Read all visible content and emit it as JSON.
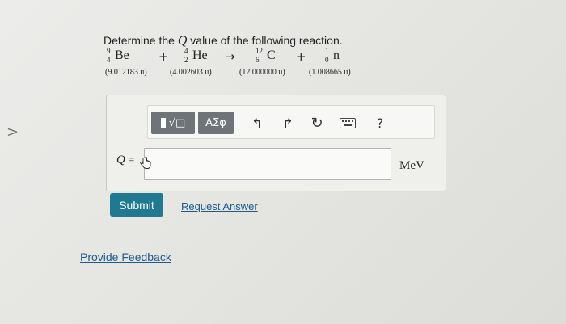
{
  "question": {
    "prefix": "Determine the ",
    "variable": "Q",
    "suffix": " value of the following reaction."
  },
  "reaction": {
    "reactant1": {
      "mass_number": "9",
      "atomic_number": "4",
      "symbol": "Be",
      "mass": "(9.012183 u)"
    },
    "plus1": "+",
    "reactant2": {
      "mass_number": "4",
      "atomic_number": "2",
      "symbol": "He",
      "mass": "(4.002603 u)"
    },
    "arrow": "→",
    "product1": {
      "mass_number": "12",
      "atomic_number": "6",
      "symbol": "C",
      "mass": "(12.000000 u)"
    },
    "plus2": "+",
    "product2": {
      "mass_number": "1",
      "atomic_number": "0",
      "symbol": "n",
      "mass": "(1.008665 u)"
    }
  },
  "toolbar": {
    "templates_label": "√□",
    "greek_label": "ΑΣφ",
    "help_label": "?"
  },
  "answer": {
    "label_var": "Q",
    "label_eq": " =",
    "value": "",
    "unit": "MeV"
  },
  "actions": {
    "submit": "Submit",
    "request_answer": "Request Answer",
    "provide_feedback": "Provide Feedback"
  },
  "colors": {
    "submit_bg": "#1f7a91",
    "link": "#1e5a8c",
    "toolbar_button": "#6f7479"
  }
}
